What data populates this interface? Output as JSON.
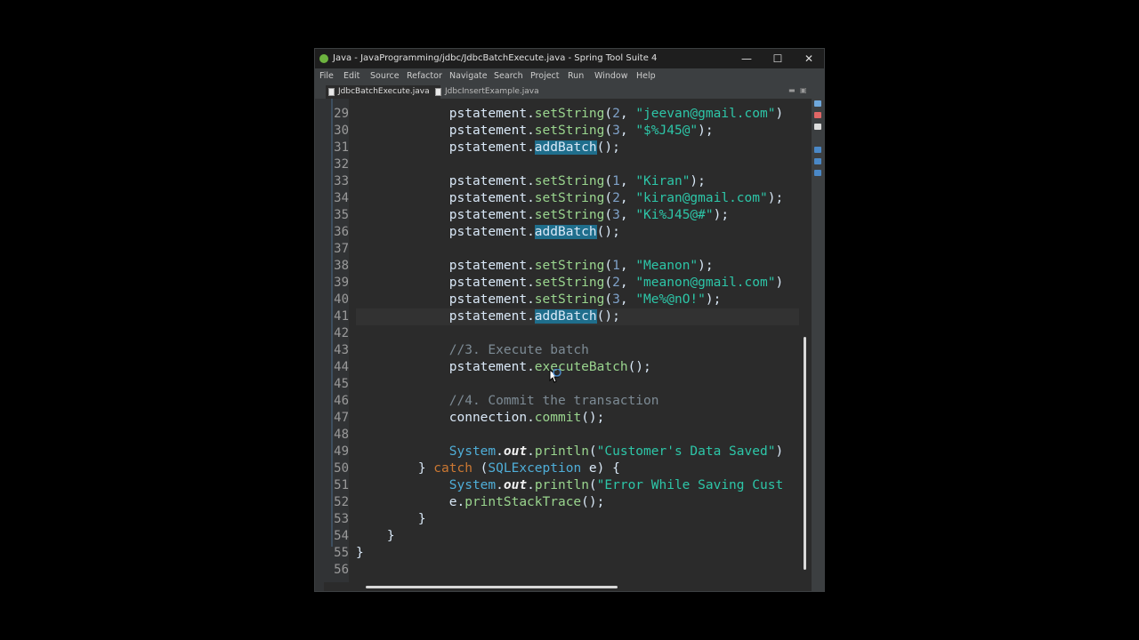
{
  "window": {
    "title": "Java - JavaProgramming/jdbc/JdbcBatchExecute.java - Spring Tool Suite 4",
    "minimize_label": "—",
    "maximize_label": "☐",
    "close_label": "✕"
  },
  "menu": [
    "File",
    "Edit",
    "Source",
    "Refactor",
    "Navigate",
    "Search",
    "Project",
    "Run",
    "Window",
    "Help"
  ],
  "tabs": [
    {
      "label": "JdbcBatchExecute.java",
      "close": "✕"
    },
    {
      "label": "JdbcInsertExample.java"
    }
  ],
  "tab_controls": {
    "minimize": "▬",
    "maximize": "▣"
  },
  "editor": {
    "lines": [
      {
        "num": "29",
        "tokens": [
          [
            "v",
            "pstatement"
          ],
          [
            "p",
            "."
          ],
          [
            "m",
            "setString"
          ],
          [
            "p",
            "("
          ],
          [
            "n",
            "2"
          ],
          [
            "p",
            ", "
          ],
          [
            "s",
            "\"jeevan@gmail.com\""
          ],
          [
            "p",
            ")"
          ]
        ]
      },
      {
        "num": "30",
        "tokens": [
          [
            "v",
            "pstatement"
          ],
          [
            "p",
            "."
          ],
          [
            "m",
            "setString"
          ],
          [
            "p",
            "("
          ],
          [
            "n",
            "3"
          ],
          [
            "p",
            ", "
          ],
          [
            "s",
            "\"$%J45@\""
          ],
          [
            "p",
            ");"
          ]
        ]
      },
      {
        "num": "31",
        "tokens": [
          [
            "v",
            "pstatement"
          ],
          [
            "p",
            "."
          ],
          [
            "hl",
            "addBatch"
          ],
          [
            "p",
            "();"
          ]
        ]
      },
      {
        "num": "32",
        "tokens": []
      },
      {
        "num": "33",
        "tokens": [
          [
            "v",
            "pstatement"
          ],
          [
            "p",
            "."
          ],
          [
            "m",
            "setString"
          ],
          [
            "p",
            "("
          ],
          [
            "n",
            "1"
          ],
          [
            "p",
            ", "
          ],
          [
            "s",
            "\"Kiran\""
          ],
          [
            "p",
            ");"
          ]
        ]
      },
      {
        "num": "34",
        "tokens": [
          [
            "v",
            "pstatement"
          ],
          [
            "p",
            "."
          ],
          [
            "m",
            "setString"
          ],
          [
            "p",
            "("
          ],
          [
            "n",
            "2"
          ],
          [
            "p",
            ", "
          ],
          [
            "s",
            "\"kiran@gmail.com\""
          ],
          [
            "p",
            ");"
          ]
        ]
      },
      {
        "num": "35",
        "tokens": [
          [
            "v",
            "pstatement"
          ],
          [
            "p",
            "."
          ],
          [
            "m",
            "setString"
          ],
          [
            "p",
            "("
          ],
          [
            "n",
            "3"
          ],
          [
            "p",
            ", "
          ],
          [
            "s",
            "\"Ki%J45@#\""
          ],
          [
            "p",
            ");"
          ]
        ]
      },
      {
        "num": "36",
        "tokens": [
          [
            "v",
            "pstatement"
          ],
          [
            "p",
            "."
          ],
          [
            "hl",
            "addBatch"
          ],
          [
            "p",
            "();"
          ]
        ]
      },
      {
        "num": "37",
        "tokens": []
      },
      {
        "num": "38",
        "tokens": [
          [
            "v",
            "pstatement"
          ],
          [
            "p",
            "."
          ],
          [
            "m",
            "setString"
          ],
          [
            "p",
            "("
          ],
          [
            "n",
            "1"
          ],
          [
            "p",
            ", "
          ],
          [
            "s",
            "\"Meanon\""
          ],
          [
            "p",
            ");"
          ]
        ]
      },
      {
        "num": "39",
        "tokens": [
          [
            "v",
            "pstatement"
          ],
          [
            "p",
            "."
          ],
          [
            "m",
            "setString"
          ],
          [
            "p",
            "("
          ],
          [
            "n",
            "2"
          ],
          [
            "p",
            ", "
          ],
          [
            "s",
            "\"meanon@gmail.com\""
          ],
          [
            "p",
            ")"
          ]
        ]
      },
      {
        "num": "40",
        "tokens": [
          [
            "v",
            "pstatement"
          ],
          [
            "p",
            "."
          ],
          [
            "m",
            "setString"
          ],
          [
            "p",
            "("
          ],
          [
            "n",
            "3"
          ],
          [
            "p",
            ", "
          ],
          [
            "s",
            "\"Me%@nO!\""
          ],
          [
            "p",
            ");"
          ]
        ]
      },
      {
        "num": "41",
        "tokens": [
          [
            "v",
            "pstatement"
          ],
          [
            "p",
            "."
          ],
          [
            "hl",
            "addBatch"
          ],
          [
            "p",
            "();"
          ]
        ],
        "current": true
      },
      {
        "num": "42",
        "tokens": []
      },
      {
        "num": "43",
        "tokens": [
          [
            "c",
            "//3. Execute batch"
          ]
        ]
      },
      {
        "num": "44",
        "tokens": [
          [
            "v",
            "pstatement"
          ],
          [
            "p",
            "."
          ],
          [
            "m",
            "executeBatch"
          ],
          [
            "p",
            "();"
          ]
        ]
      },
      {
        "num": "45",
        "tokens": []
      },
      {
        "num": "46",
        "tokens": [
          [
            "c",
            "//4. Commit the transaction"
          ]
        ]
      },
      {
        "num": "47",
        "tokens": [
          [
            "v",
            "connection"
          ],
          [
            "p",
            "."
          ],
          [
            "m",
            "commit"
          ],
          [
            "p",
            "();"
          ]
        ]
      },
      {
        "num": "48",
        "tokens": []
      },
      {
        "num": "49",
        "tokens": [
          [
            "t",
            "System"
          ],
          [
            "p",
            "."
          ],
          [
            "sf",
            "out"
          ],
          [
            "p",
            "."
          ],
          [
            "m",
            "println"
          ],
          [
            "p",
            "("
          ],
          [
            "s",
            "\"Customer's Data Saved\""
          ],
          [
            "p",
            ")"
          ]
        ]
      },
      {
        "num": "50",
        "indent": 2,
        "tokens": [
          [
            "p",
            "} "
          ],
          [
            "k",
            "catch"
          ],
          [
            "p",
            " ("
          ],
          [
            "t",
            "SQLException"
          ],
          [
            "p",
            " "
          ],
          [
            "v",
            "e"
          ],
          [
            "p",
            ") {"
          ]
        ]
      },
      {
        "num": "51",
        "tokens": [
          [
            "t",
            "System"
          ],
          [
            "p",
            "."
          ],
          [
            "sf",
            "out"
          ],
          [
            "p",
            "."
          ],
          [
            "m",
            "println"
          ],
          [
            "p",
            "("
          ],
          [
            "s",
            "\"Error While Saving Cust"
          ]
        ]
      },
      {
        "num": "52",
        "tokens": [
          [
            "v",
            "e"
          ],
          [
            "p",
            "."
          ],
          [
            "m",
            "printStackTrace"
          ],
          [
            "p",
            "();"
          ]
        ]
      },
      {
        "num": "53",
        "indent": 2,
        "tokens": [
          [
            "p",
            "}"
          ]
        ]
      },
      {
        "num": "54",
        "indent": 1,
        "tokens": [
          [
            "p",
            "}"
          ]
        ]
      },
      {
        "num": "55",
        "indent": 0,
        "tokens": [
          [
            "p",
            "}"
          ]
        ]
      },
      {
        "num": "56",
        "tokens": []
      }
    ]
  },
  "colors": {
    "editor_bg": "#2b2b2b",
    "string": "#2dc6a8",
    "method": "#9ad58e",
    "comment": "#7d8b95",
    "keyword": "#cc7832",
    "type": "#4faed8",
    "highlight": "#1f6e8c"
  },
  "icons": [
    "spring-leaf-icon",
    "java-file-icon",
    "mouse-cursor-icon"
  ]
}
